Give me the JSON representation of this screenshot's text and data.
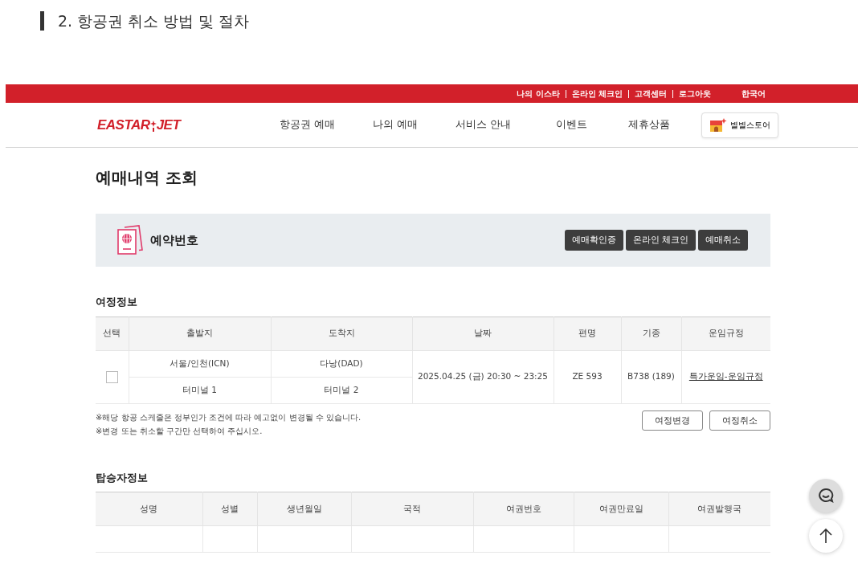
{
  "post_heading": "2. 항공권 취소 방법 및 절차",
  "site": {
    "top_links": [
      "나의 이스타",
      "온라인 체크인",
      "고객센터",
      "로그아웃"
    ],
    "language": "한국어",
    "logo": {
      "left": "EASTAR",
      "right": "JET"
    },
    "nav": [
      "항공권 예매",
      "나의 예매",
      "서비스 안내",
      "이벤트",
      "제휴상품"
    ],
    "store_button": "별별스토어",
    "page_title": "예매내역 조회",
    "booking": {
      "label": "예약번호",
      "buttons": [
        "예매확인증",
        "온라인 체크인",
        "예매취소"
      ]
    },
    "itinerary": {
      "title": "여정정보",
      "columns": [
        "선택",
        "출발지",
        "도착지",
        "날짜",
        "편명",
        "기종",
        "운임규정"
      ],
      "rows": [
        {
          "checked": false,
          "from": "서울/인천(ICN)",
          "from_terminal": "터미널 1",
          "to": "다낭(DAD)",
          "to_terminal": "터미널 2",
          "date": "2025.04.25 (금) 20:30 ~ 23:25",
          "flight": "ZE 593",
          "aircraft": "B738 (189)",
          "fare_rule": "특가운임-운임규정"
        }
      ],
      "notes": [
        "※해당 항공 스케줄은 정부인가 조건에 따라 예고없이 변경될 수 있습니다.",
        "※변경 또는 취소할 구간만 선택하여 주십시오."
      ],
      "buttons": [
        "여정변경",
        "여정취소"
      ]
    },
    "passengers": {
      "title": "탑승자정보",
      "columns": [
        "성명",
        "성별",
        "생년월일",
        "국적",
        "여권번호",
        "여권만료일",
        "여권발행국"
      ],
      "rows": [
        [
          "",
          "",
          "",
          "",
          "",
          "",
          ""
        ]
      ]
    }
  }
}
